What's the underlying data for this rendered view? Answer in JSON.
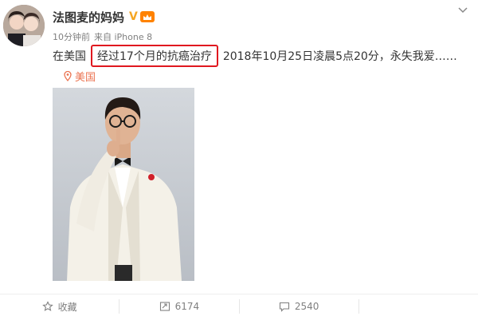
{
  "user": {
    "name": "法图麦的妈妈",
    "verified_mark": "V",
    "meta_time": "10分钟前",
    "meta_source": "来自 iPhone 8"
  },
  "post": {
    "text_before": "在美国",
    "highlighted": "经过17个月的抗癌治疗",
    "text_after": "2018年10月25日凌晨5点20分，永失我爱……"
  },
  "location": {
    "label": "美国"
  },
  "actions": {
    "favorite_label": "收藏",
    "repost_count": "6174",
    "comment_count": "2540"
  },
  "colors": {
    "highlight_border": "#e0181f",
    "location_color": "#eb7350",
    "verified_color": "#f5a623",
    "level_badge": "#ff8200"
  },
  "icons": {
    "chevron": "chevron-down-icon",
    "location": "location-pin-icon",
    "favorite": "star-icon",
    "repost": "repost-icon",
    "comment": "comment-icon"
  }
}
